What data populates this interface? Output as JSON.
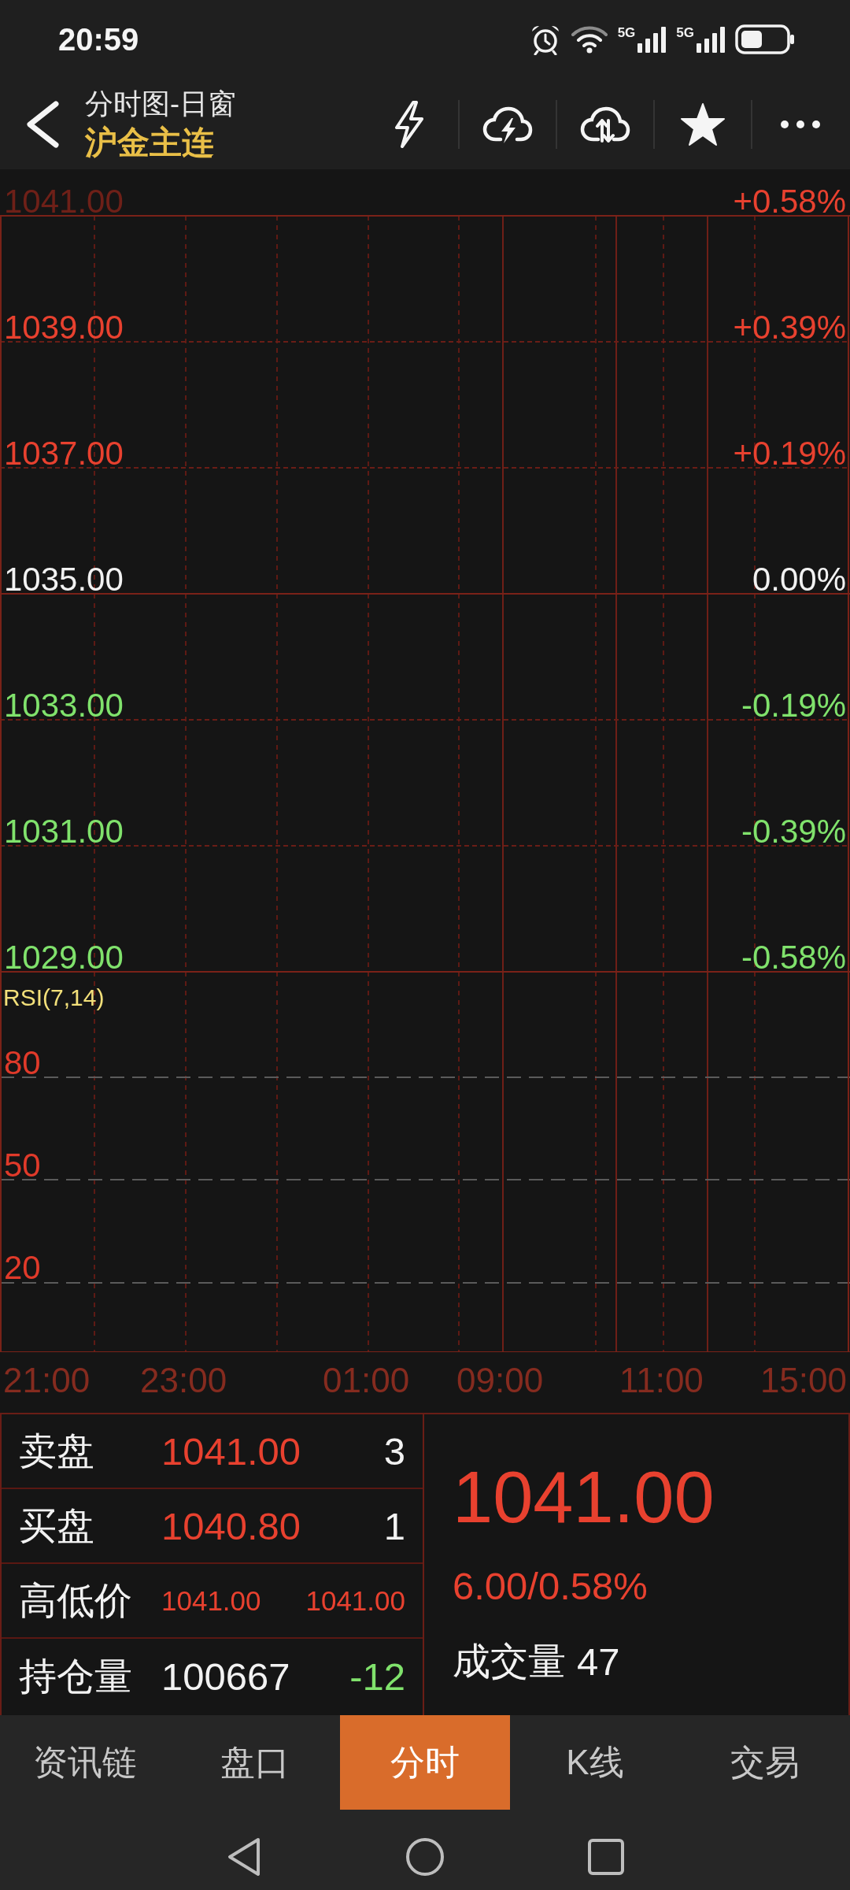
{
  "status_bar": {
    "time": "20:59",
    "signals": [
      {
        "network": "5G"
      },
      {
        "network": "5G"
      }
    ]
  },
  "header": {
    "title": "分时图-日窗",
    "subtitle": "沪金主连"
  },
  "price_chart": {
    "rows": [
      {
        "price": "1041.00",
        "percent": "+0.58%",
        "color": "#e8412f",
        "muted": true
      },
      {
        "price": "1039.00",
        "percent": "+0.39%",
        "color": "#e8412f",
        "muted": false
      },
      {
        "price": "1037.00",
        "percent": "+0.19%",
        "color": "#e8412f",
        "muted": false
      },
      {
        "price": "1035.00",
        "percent": "0.00%",
        "color": "#f2f2f2",
        "muted": false
      },
      {
        "price": "1033.00",
        "percent": "-0.19%",
        "color": "#80e26c",
        "muted": false
      },
      {
        "price": "1031.00",
        "percent": "-0.39%",
        "color": "#80e26c",
        "muted": false
      },
      {
        "price": "1029.00",
        "percent": "-0.58%",
        "color": "#80e26c",
        "muted": false
      }
    ],
    "indicator": {
      "title": "RSI(7,14)",
      "levels": [
        "80",
        "50",
        "20"
      ]
    },
    "time_labels": [
      "21:00",
      "23:00",
      "01:00",
      "09:00",
      "11:00",
      "15:00"
    ]
  },
  "quote": {
    "rows": [
      {
        "kind": "order",
        "label": "卖盘",
        "price": "1041.00",
        "volume": "3"
      },
      {
        "kind": "order",
        "label": "买盘",
        "price": "1040.80",
        "volume": "1"
      },
      {
        "kind": "range",
        "label": "高低价",
        "high": "1041.00",
        "low": "1041.00"
      },
      {
        "kind": "open_interest",
        "label": "持仓量",
        "value": "100667",
        "change": "-12",
        "color": "#80e26c"
      }
    ],
    "last_price": "1041.00",
    "change": "6.00/0.58%",
    "volume_label": "成交量",
    "volume": "47"
  },
  "tabs": [
    {
      "label": "资讯链",
      "selected": false
    },
    {
      "label": "盘口",
      "selected": false
    },
    {
      "label": "分时",
      "selected": true
    },
    {
      "label": "K线",
      "selected": false
    },
    {
      "label": "交易",
      "selected": false
    }
  ]
}
